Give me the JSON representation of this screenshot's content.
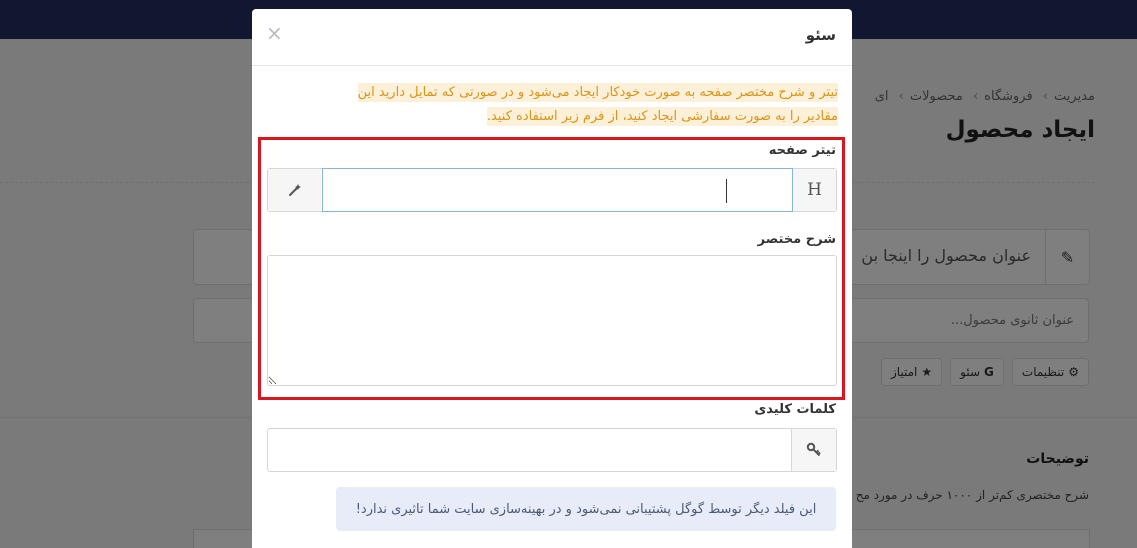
{
  "background": {
    "breadcrumb": [
      "مدیریت",
      "فروشگاه",
      "محصولات",
      "ای"
    ],
    "page_title": "ایجاد محصول",
    "product_title_placeholder": "عنوان محصول را اینجا بن",
    "subtitle_placeholder": "عنوان ثانوی محصول...",
    "tabs": [
      {
        "label": "تنظیمات",
        "icon": "gear-icon",
        "glyph": "⚙"
      },
      {
        "label": "سئو",
        "icon": "google-g-icon",
        "glyph": "G"
      },
      {
        "label": "امتیاز",
        "icon": "star-icon",
        "glyph": "★"
      }
    ],
    "description_title": "توضیحات",
    "description_text": "شرح مختصری کم‌تر از ۱۰۰۰ حرف در مورد مح"
  },
  "modal": {
    "title": "سئو",
    "close_glyph": "×",
    "notice_line1": "تیتر و شرح مختصر صفحه به صورت خودکار ایجاد می‌شود و در صورتی که تمایل دارید این",
    "notice_line2": "مقادیر را به صورت سفارشی ایجاد کنید، از فرم زیر استفاده کنید.",
    "page_title_label": "تیتر صفحه",
    "page_title_value": "",
    "page_title_prefix": "H",
    "short_description_label": "شرح مختصر",
    "short_description_value": "",
    "keywords_label": "کلمات کلیدی",
    "keywords_value": "",
    "info_text": "این فیلد دیگر توسط گوگل پشتیبانی نمی‌شود و در بهینه‌سازی سایت شما تاثیری ندارد!"
  },
  "colors": {
    "topbar": "#232c63",
    "highlight": "#d9161e",
    "notice_text": "#d8951a",
    "notice_bg": "#fdf0d8",
    "info_bg": "#e8ecf8"
  }
}
